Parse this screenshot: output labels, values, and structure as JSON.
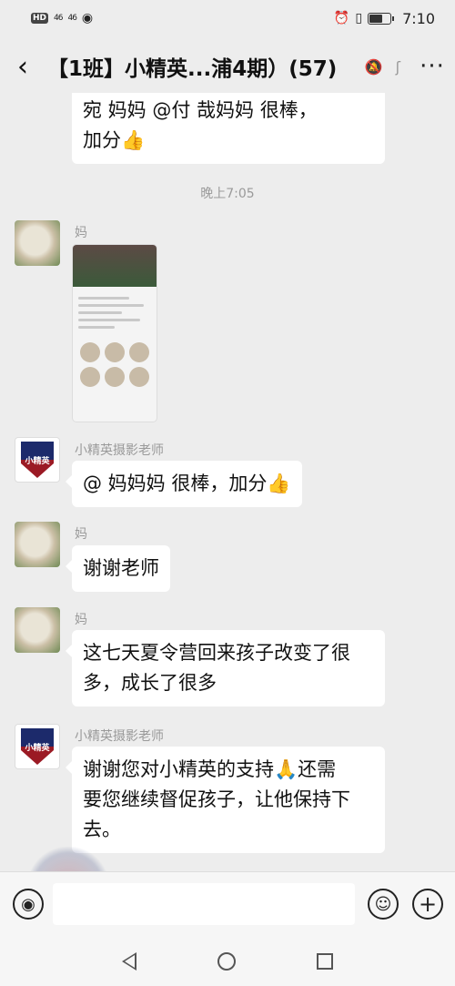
{
  "status_bar": {
    "hd": "HD",
    "signal_1": "46",
    "signal_2": "46",
    "time": "7:10"
  },
  "header": {
    "back_glyph": "‹",
    "title": "【1班】小精英...浦4期）(57)",
    "mute_icon": "bell-off-icon",
    "ear_icon": "ear-icon",
    "more_glyph": "···"
  },
  "messages": [
    {
      "type": "text",
      "text_line1": "宛  妈妈 @付  哉妈妈  很棒，",
      "text_line2": "加分👍"
    },
    {
      "type": "timestamp",
      "text": "晚上7:05"
    },
    {
      "type": "image",
      "sender": "  妈",
      "avatar": "mushroom"
    },
    {
      "type": "text",
      "sender": "小精英摄影老师",
      "avatar": "crest",
      "text": "@  妈妈妈 很棒，加分👍"
    },
    {
      "type": "text",
      "sender": "  妈",
      "avatar": "mushroom",
      "text": "谢谢老师"
    },
    {
      "type": "text",
      "sender": "  妈",
      "avatar": "mushroom",
      "text_line1": "这七天夏令营回来孩子改变了很",
      "text_line2": "多，成长了很多"
    },
    {
      "type": "text",
      "sender": "小精英摄影老师",
      "avatar": "crest",
      "text_line1": "谢谢您对小精英的支持🙏还需",
      "text_line2": "要您继续督促孩子，让他保持下",
      "text_line3": "去。"
    }
  ],
  "crest_text": "小精英",
  "input_bar": {
    "voice_glyph": "◉",
    "emoji_glyph": "☺",
    "plus_glyph": "+"
  },
  "watermark_text": "小精英"
}
